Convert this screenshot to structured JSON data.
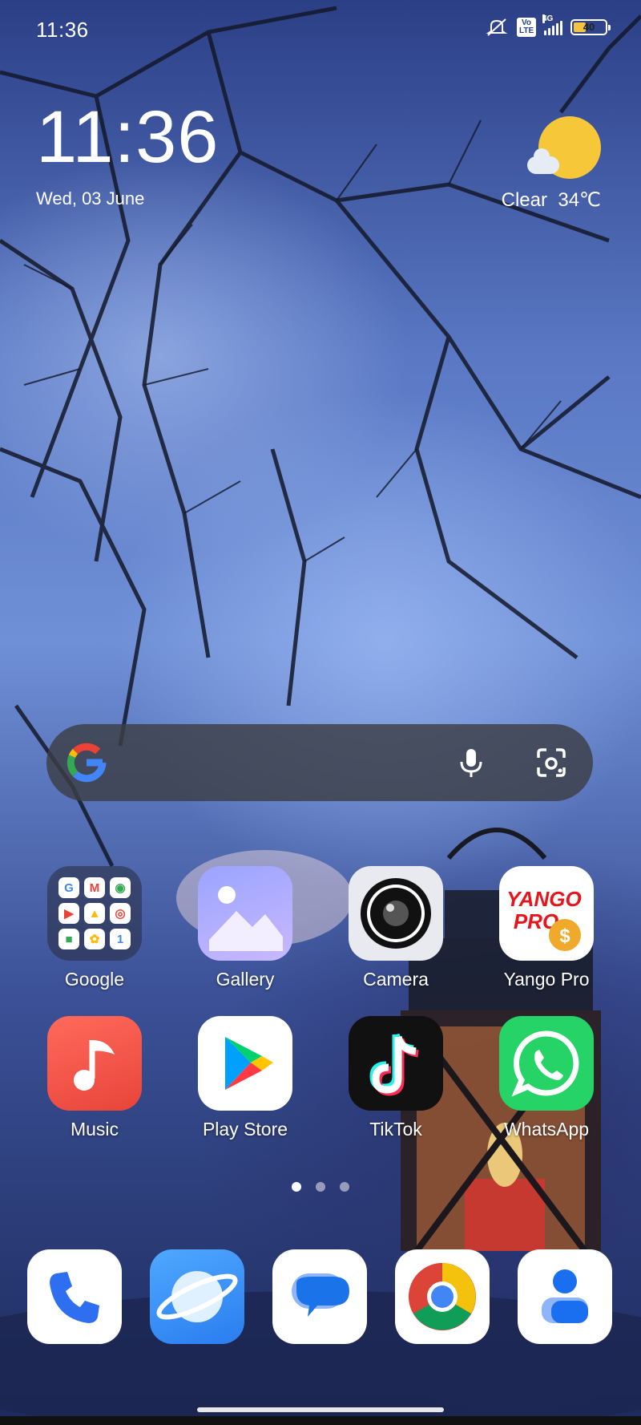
{
  "status_bar": {
    "time": "11:36",
    "volte": "Vo LTE",
    "network": "4G",
    "battery": "40",
    "battery_level": 0.4
  },
  "clock_widget": {
    "time": "11:36",
    "date": "Wed, 03 June"
  },
  "weather": {
    "condition": "Clear",
    "temperature": "34℃",
    "icon": "sun-cloud-icon"
  },
  "search_bar": {
    "logo": "google-g-icon",
    "mic": "mic-icon",
    "lens": "lens-icon"
  },
  "apps": [
    {
      "label": "Google",
      "icon": "google-folder-icon"
    },
    {
      "label": "Gallery",
      "icon": "gallery-icon"
    },
    {
      "label": "Camera",
      "icon": "camera-icon"
    },
    {
      "label": "Yango Pro",
      "icon": "yango-pro-icon",
      "logo_text": "YANGO PRO"
    },
    {
      "label": "Music",
      "icon": "music-icon"
    },
    {
      "label": "Play Store",
      "icon": "play-store-icon"
    },
    {
      "label": "TikTok",
      "icon": "tiktok-icon"
    },
    {
      "label": "WhatsApp",
      "icon": "whatsapp-icon"
    }
  ],
  "page_indicator": {
    "pages": 3,
    "current": 1
  },
  "dock": [
    {
      "icon": "phone-icon"
    },
    {
      "icon": "browser-icon"
    },
    {
      "icon": "messages-icon"
    },
    {
      "icon": "chrome-icon"
    },
    {
      "icon": "contacts-icon"
    }
  ],
  "colors": {
    "sun": "#f7c73a",
    "search_bg": "#3c3e46",
    "whatsapp": "#25d366",
    "music": "#f2564a",
    "tiktok_bg": "#111111"
  }
}
